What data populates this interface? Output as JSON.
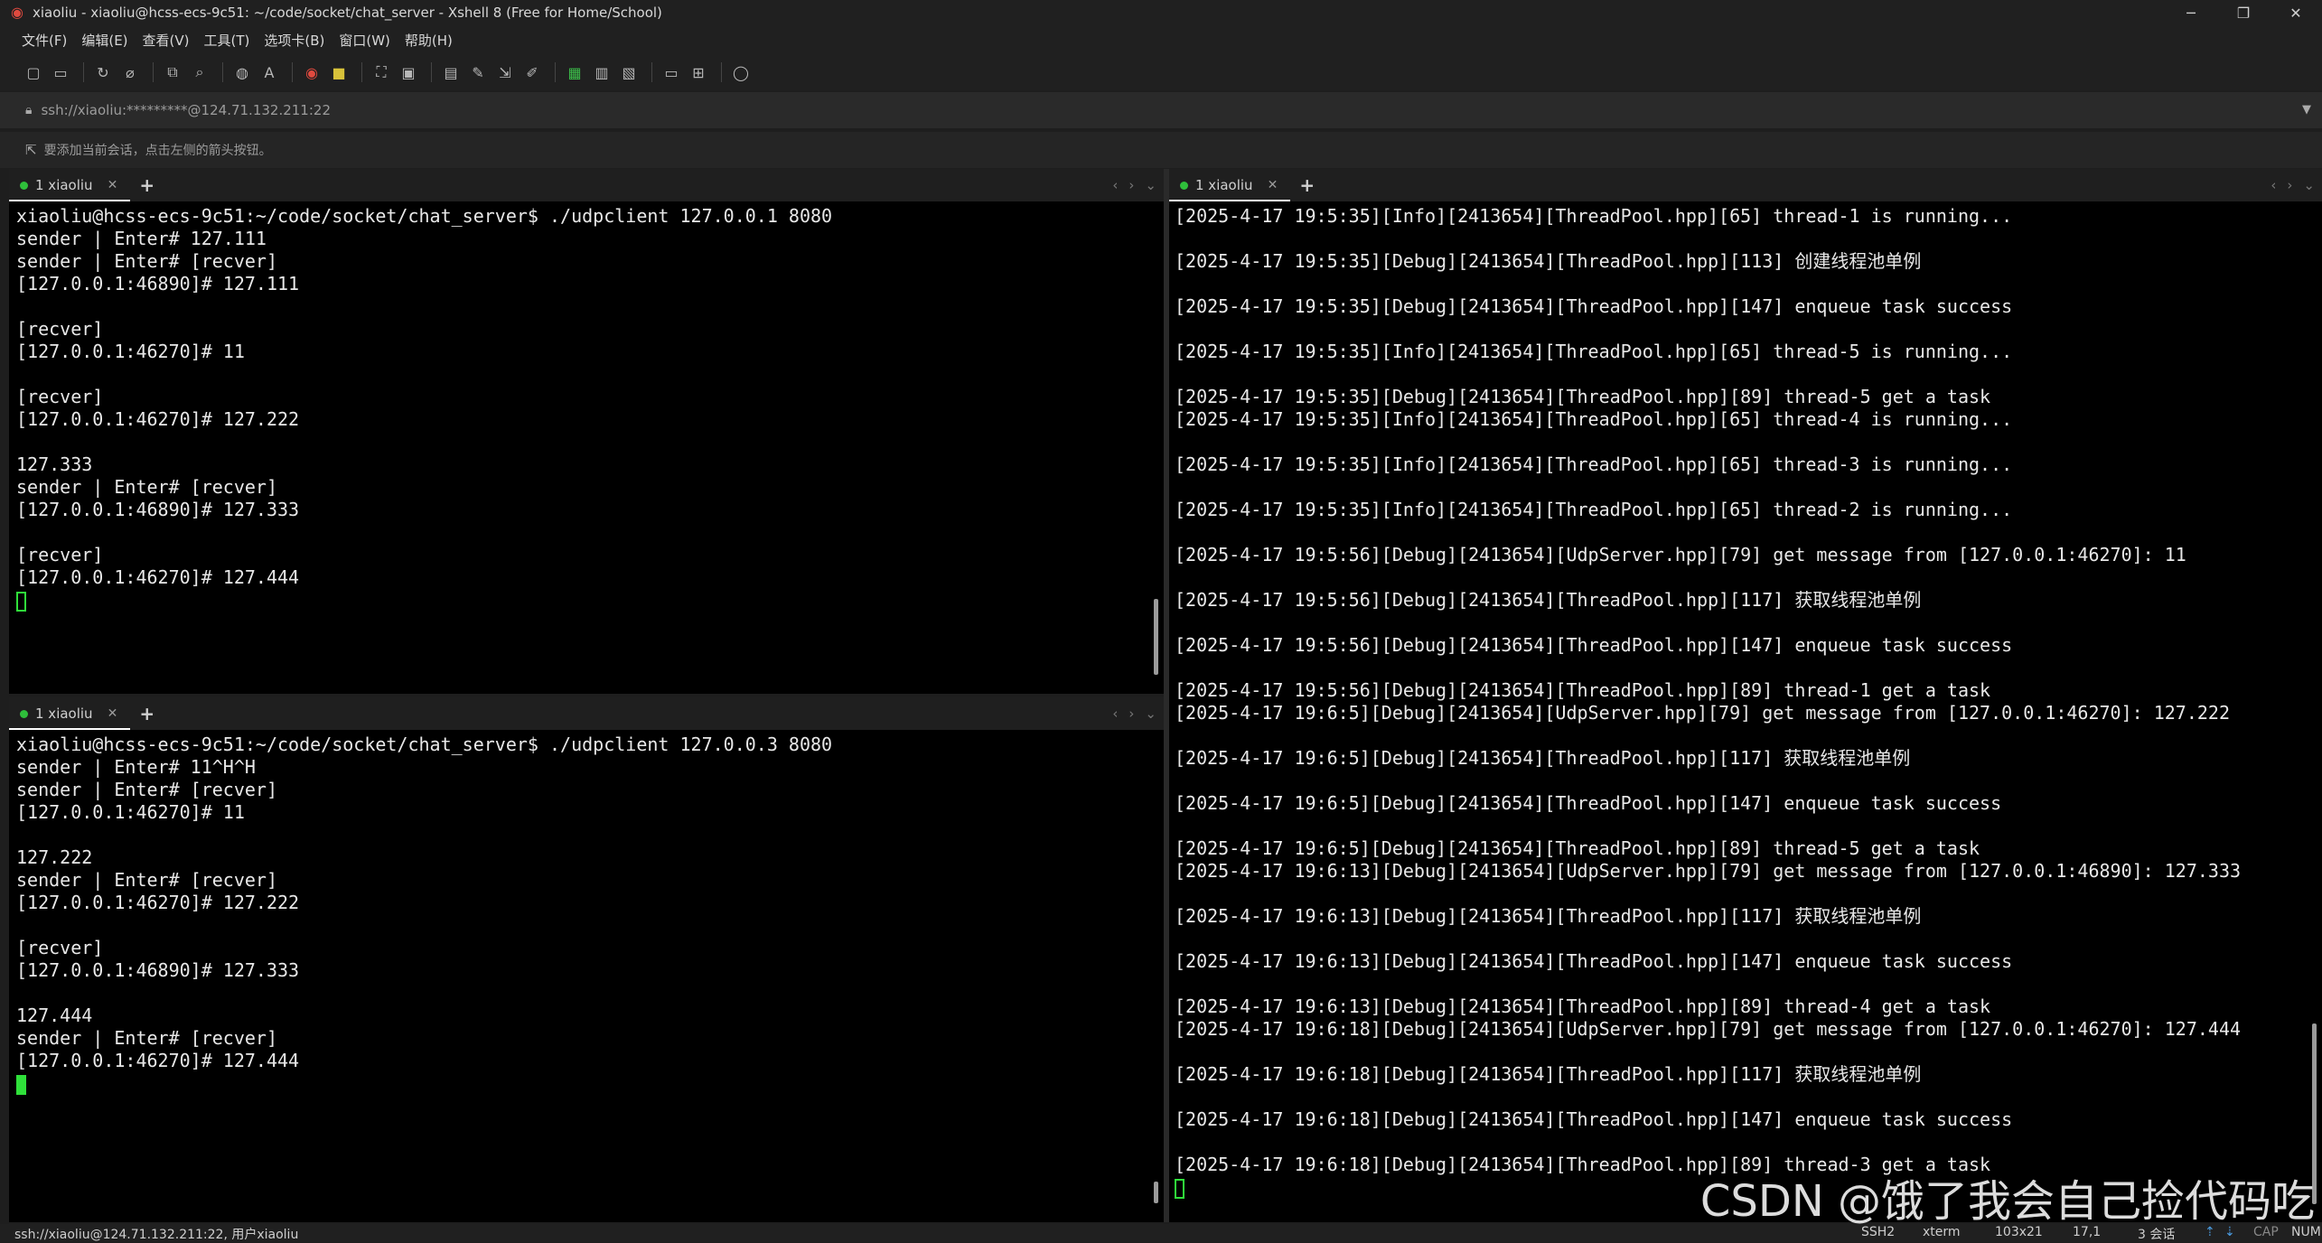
{
  "window": {
    "title": "xiaoliu - xiaoliu@hcss-ecs-9c51: ~/code/socket/chat_server - Xshell 8 (Free for Home/School)",
    "logo_icon": "xshell-logo-icon",
    "minimize": "─",
    "maximize": "❐",
    "close": "✕"
  },
  "menu": [
    "文件(F)",
    "编辑(E)",
    "查看(V)",
    "工具(T)",
    "选项卡(B)",
    "窗口(W)",
    "帮助(H)"
  ],
  "toolbar": {
    "icons": [
      "new-session-icon",
      "open-folder-icon",
      "reconnect-icon",
      "disconnect-icon",
      "new-tab-icon",
      "find-icon",
      "globe-icon",
      "font-icon",
      "xshell-icon",
      "xftp-icon",
      "fullscreen-icon",
      "lock-icon",
      "keyboard-icon",
      "script-icon",
      "transfer-icon",
      "compose-icon",
      "log-icon",
      "split-icon",
      "layout-icon",
      "help-icon"
    ]
  },
  "address": {
    "text": "ssh://xiaoliu:*********@124.71.132.211:22"
  },
  "hint": {
    "text": "要添加当前会话，点击左侧的箭头按钮。"
  },
  "panes": {
    "top_left": {
      "tab_label": "1 xiaoliu",
      "lines": [
        "xiaoliu@hcss-ecs-9c51:~/code/socket/chat_server$ ./udpclient 127.0.0.1 8080",
        "sender | Enter# 127.111",
        "sender | Enter# [recver]",
        "[127.0.0.1:46890]# 127.111",
        "",
        "[recver]",
        "[127.0.0.1:46270]# 11",
        "",
        "[recver]",
        "[127.0.0.1:46270]# 127.222",
        "",
        "127.333",
        "sender | Enter# [recver]",
        "[127.0.0.1:46890]# 127.333",
        "",
        "[recver]",
        "[127.0.0.1:46270]# 127.444",
        ""
      ]
    },
    "bottom_left": {
      "tab_label": "1 xiaoliu",
      "lines": [
        "xiaoliu@hcss-ecs-9c51:~/code/socket/chat_server$ ./udpclient 127.0.0.3 8080",
        "sender | Enter# 11^H^H",
        "sender | Enter# [recver]",
        "[127.0.0.1:46270]# 11",
        "",
        "127.222",
        "sender | Enter# [recver]",
        "[127.0.0.1:46270]# 127.222",
        "",
        "[recver]",
        "[127.0.0.1:46890]# 127.333",
        "",
        "127.444",
        "sender | Enter# [recver]",
        "[127.0.0.1:46270]# 127.444",
        ""
      ]
    },
    "right": {
      "tab_label": "1 xiaoliu",
      "lines": [
        "[2025-4-17 19:5:35][Info][2413654][ThreadPool.hpp][65] thread-1 is running...",
        "",
        "[2025-4-17 19:5:35][Debug][2413654][ThreadPool.hpp][113] 创建线程池单例",
        "",
        "[2025-4-17 19:5:35][Debug][2413654][ThreadPool.hpp][147] enqueue task success",
        "",
        "[2025-4-17 19:5:35][Info][2413654][ThreadPool.hpp][65] thread-5 is running...",
        "",
        "[2025-4-17 19:5:35][Debug][2413654][ThreadPool.hpp][89] thread-5 get a task",
        "[2025-4-17 19:5:35][Info][2413654][ThreadPool.hpp][65] thread-4 is running...",
        "",
        "[2025-4-17 19:5:35][Info][2413654][ThreadPool.hpp][65] thread-3 is running...",
        "",
        "[2025-4-17 19:5:35][Info][2413654][ThreadPool.hpp][65] thread-2 is running...",
        "",
        "[2025-4-17 19:5:56][Debug][2413654][UdpServer.hpp][79] get message from [127.0.0.1:46270]: 11",
        "",
        "[2025-4-17 19:5:56][Debug][2413654][ThreadPool.hpp][117] 获取线程池单例",
        "",
        "[2025-4-17 19:5:56][Debug][2413654][ThreadPool.hpp][147] enqueue task success",
        "",
        "[2025-4-17 19:5:56][Debug][2413654][ThreadPool.hpp][89] thread-1 get a task",
        "[2025-4-17 19:6:5][Debug][2413654][UdpServer.hpp][79] get message from [127.0.0.1:46270]: 127.222",
        "",
        "[2025-4-17 19:6:5][Debug][2413654][ThreadPool.hpp][117] 获取线程池单例",
        "",
        "[2025-4-17 19:6:5][Debug][2413654][ThreadPool.hpp][147] enqueue task success",
        "",
        "[2025-4-17 19:6:5][Debug][2413654][ThreadPool.hpp][89] thread-5 get a task",
        "[2025-4-17 19:6:13][Debug][2413654][UdpServer.hpp][79] get message from [127.0.0.1:46890]: 127.333",
        "",
        "[2025-4-17 19:6:13][Debug][2413654][ThreadPool.hpp][117] 获取线程池单例",
        "",
        "[2025-4-17 19:6:13][Debug][2413654][ThreadPool.hpp][147] enqueue task success",
        "",
        "[2025-4-17 19:6:13][Debug][2413654][ThreadPool.hpp][89] thread-4 get a task",
        "[2025-4-17 19:6:18][Debug][2413654][UdpServer.hpp][79] get message from [127.0.0.1:46270]: 127.444",
        "",
        "[2025-4-17 19:6:18][Debug][2413654][ThreadPool.hpp][117] 获取线程池单例",
        "",
        "[2025-4-17 19:6:18][Debug][2413654][ThreadPool.hpp][147] enqueue task success",
        "",
        "[2025-4-17 19:6:18][Debug][2413654][ThreadPool.hpp][89] thread-3 get a task"
      ]
    }
  },
  "status": {
    "connection": "ssh://xiaoliu@124.71.132.211:22, 用户xiaoliu",
    "protocol": "SSH2",
    "terminal": "xterm",
    "size": "103x21",
    "position": "17,1",
    "sessions": "3 会话",
    "cap": "CAP",
    "num": "NUM"
  },
  "watermark": "CSDN @饿了我会自己捡代码吃",
  "colors": {
    "terminal_bg": "#000000",
    "terminal_fg": "#e8e8e8",
    "cursor": "#2fe03a",
    "tab_dot": "#2fbf3b",
    "chrome_bg": "#202020"
  }
}
